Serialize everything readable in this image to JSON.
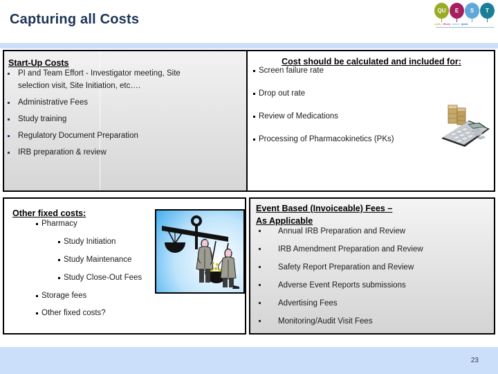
{
  "slide": {
    "title": "Capturing all Costs",
    "page_number": "23"
  },
  "logo": {
    "name": "quest-logo",
    "letters": [
      {
        "text": "QU",
        "color": "#9aab24"
      },
      {
        "text": "E",
        "color": "#a51e5f"
      },
      {
        "text": "S",
        "color": "#5fa8d8"
      },
      {
        "text": "T",
        "color": "#1a7f96"
      }
    ],
    "subtitles": [
      "quality",
      "efficacy",
      "science",
      "Team"
    ],
    "mark": "Quest"
  },
  "colors": {
    "title": "#1b3455",
    "band": "#cbdefa",
    "footer": "#cbdefa",
    "border": "#000000",
    "bullet_navy": "#253f6e",
    "bullet_black": "#000000"
  },
  "top_table": {
    "startup": {
      "header": "Start-Up Costs",
      "items": [
        "PI and Team Effort - Investigator meeting, Site",
        "selection visit, Site Initiation, etc….",
        "Administrative Fees",
        "Study training",
        "Regulatory Document Preparation",
        "IRB preparation & review"
      ]
    },
    "included": {
      "header": "Cost should be calculated and included for:",
      "items": [
        "Screen failure rate",
        "Drop out rate",
        "Review of Medications",
        "Processing of Pharmacokinetics (PKs)"
      ],
      "clipart_name": "calculator-and-money-clipart"
    }
  },
  "other_fixed": {
    "header": "Other fixed costs:",
    "items": [
      {
        "label": "Pharmacy",
        "level": 0
      },
      {
        "label": "Study Initiation",
        "level": 2
      },
      {
        "label": "Study Maintenance",
        "level": 2
      },
      {
        "label": "Study Close-Out Fees",
        "level": 2
      },
      {
        "label": "Storage fees",
        "level": 1
      },
      {
        "label": "Other fixed costs?",
        "level": 1
      }
    ],
    "clipart_name": "balance-scale-clipart"
  },
  "event_based": {
    "header_line1": "Event Based (Invoiceable) Fees –",
    "header_line2": "As Applicable",
    "items": [
      "Annual IRB Preparation and Review",
      "IRB Amendment Preparation and Review",
      "Safety Report Preparation and Review",
      "Adverse Event Reports submissions",
      "Advertising Fees",
      "Monitoring/Audit Visit Fees"
    ]
  }
}
